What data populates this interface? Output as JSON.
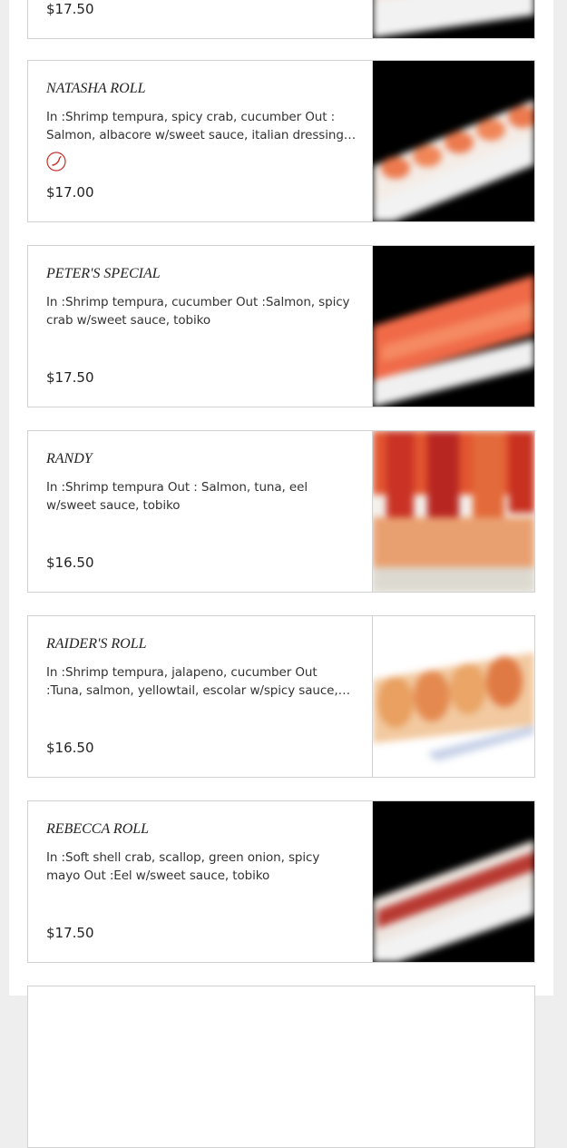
{
  "menu": {
    "items": [
      {
        "id": "top",
        "name": "",
        "description": "",
        "price": "$17.50",
        "spicy": false,
        "photo": "dish-photo-dark"
      },
      {
        "id": "natasha",
        "name": "NATASHA ROLL",
        "description": "In :Shrimp tempura, spicy crab, cucumber Out : Salmon, albacore w/sweet sauce, italian dressing, tobiko",
        "price": "$17.00",
        "spicy": true,
        "photo": "dish-photo-dark"
      },
      {
        "id": "peters",
        "name": "PETER'S SPECIAL",
        "description": "In :Shrimp tempura, cucumber Out :Salmon, spicy crab w/sweet sauce, tobiko",
        "price": "$17.50",
        "spicy": false,
        "photo": "dish-photo-dark"
      },
      {
        "id": "randy",
        "name": "RANDY",
        "description": "In :Shrimp tempura Out : Salmon, tuna, eel w/sweet sauce, tobiko",
        "price": "$16.50",
        "spicy": false,
        "photo": "dish-photo-light"
      },
      {
        "id": "raider",
        "name": "RAIDER'S ROLL",
        "description": "In :Shrimp tempura, jalapeno, cucumber Out :Tuna, salmon, yellowtail, escolar w/spicy sauce, tobiko",
        "price": "$16.50",
        "spicy": false,
        "photo": "dish-photo-white"
      },
      {
        "id": "rebecca",
        "name": "REBECCA ROLL",
        "description": "In :Soft shell crab, scallop, green onion, spicy mayo Out :Eel w/sweet sauce, tobiko",
        "price": "$17.50",
        "spicy": false,
        "photo": "dish-photo-dark"
      }
    ]
  },
  "icons": {
    "spicy": "chili-pepper-icon"
  },
  "colors": {
    "spicy_red": "#c4302b",
    "border": "#d2d2d2",
    "page_bg": "#eeeeee"
  }
}
